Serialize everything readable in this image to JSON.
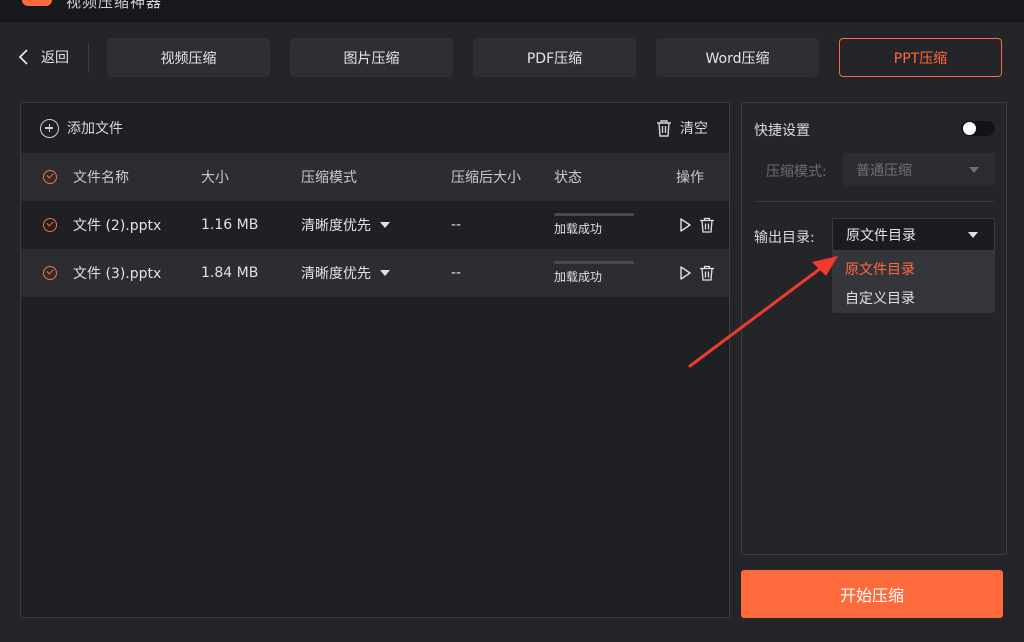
{
  "app": {
    "title": "视频压缩神器"
  },
  "nav": {
    "back_label": "返回",
    "tabs": [
      {
        "label": "视频压缩",
        "active": false
      },
      {
        "label": "图片压缩",
        "active": false
      },
      {
        "label": "PDF压缩",
        "active": false
      },
      {
        "label": "Word压缩",
        "active": false
      },
      {
        "label": "PPT压缩",
        "active": true
      }
    ]
  },
  "toolbar": {
    "add_label": "添加文件",
    "clear_label": "清空"
  },
  "table": {
    "headers": {
      "name": "文件名称",
      "size": "大小",
      "mode": "压缩模式",
      "after": "压缩后大小",
      "status": "状态",
      "ops": "操作"
    },
    "rows": [
      {
        "name": "文件 (2).pptx",
        "size": "1.16 MB",
        "mode": "清晰度优先",
        "after": "--",
        "status": "加载成功",
        "progress": 0
      },
      {
        "name": "文件 (3).pptx",
        "size": "1.84 MB",
        "mode": "清晰度优先",
        "after": "--",
        "status": "加载成功",
        "progress": 0
      }
    ]
  },
  "settings": {
    "quick_label": "快捷设置",
    "quick_enabled": false,
    "mode_label": "压缩模式:",
    "mode_value": "普通压缩",
    "output_label": "输出目录:",
    "output_value": "原文件目录",
    "output_options": [
      {
        "label": "原文件目录",
        "selected": true
      },
      {
        "label": "自定义目录",
        "selected": false
      }
    ]
  },
  "start_label": "开始压缩",
  "colors": {
    "accent": "#ff6a3d",
    "annotation_arrow": "#f03a30"
  },
  "icons": {
    "back": "chevron-left-icon",
    "add": "plus-circle-icon",
    "clear": "trash-icon",
    "check": "check-circle-icon",
    "caret": "caret-down-icon",
    "play": "play-icon",
    "delete": "trash-icon"
  }
}
